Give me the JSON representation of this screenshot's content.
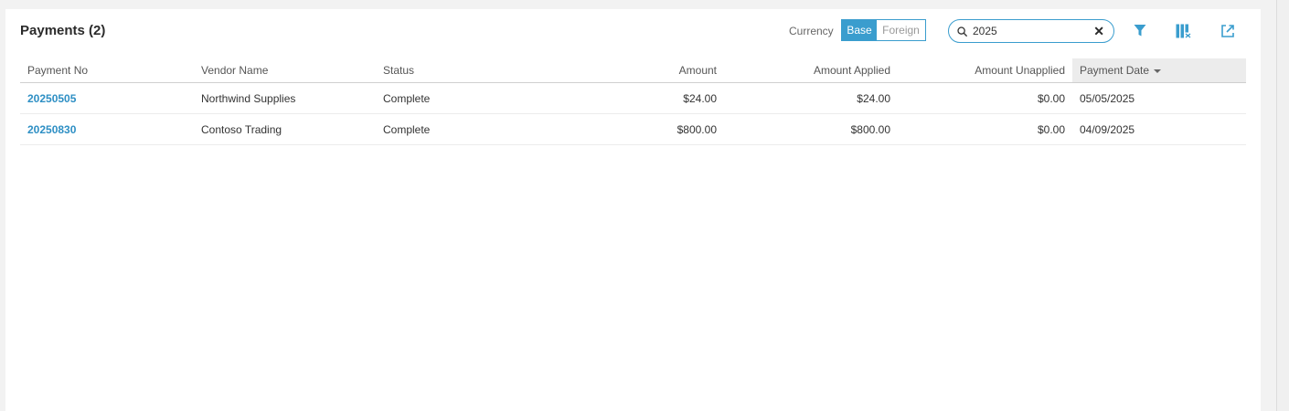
{
  "page": {
    "title": "Payments (2)"
  },
  "currency": {
    "label": "Currency",
    "options": [
      "Base",
      "Foreign"
    ],
    "selected": "Base"
  },
  "search": {
    "value": "2025",
    "clear_glyph": "✕"
  },
  "toolbar": {
    "icons": [
      "filter-icon",
      "columns-icon",
      "export-icon"
    ]
  },
  "colors": {
    "accent": "#3a9dce",
    "link": "#2e8fc4"
  },
  "table": {
    "columns": {
      "payment_no": "Payment No",
      "vendor_name": "Vendor Name",
      "status": "Status",
      "amount": "Amount",
      "amount_applied": "Amount Applied",
      "amount_unapplied": "Amount Unapplied",
      "payment_date": "Payment Date"
    },
    "sorted_by": "payment_date",
    "rows": [
      {
        "payment_no": "20250505",
        "vendor_name": "Northwind Supplies",
        "status": "Complete",
        "amount": "$24.00",
        "amount_applied": "$24.00",
        "amount_unapplied": "$0.00",
        "payment_date": "05/05/2025"
      },
      {
        "payment_no": "20250830",
        "vendor_name": "Contoso Trading",
        "status": "Complete",
        "amount": "$800.00",
        "amount_applied": "$800.00",
        "amount_unapplied": "$0.00",
        "payment_date": "04/09/2025"
      }
    ]
  }
}
